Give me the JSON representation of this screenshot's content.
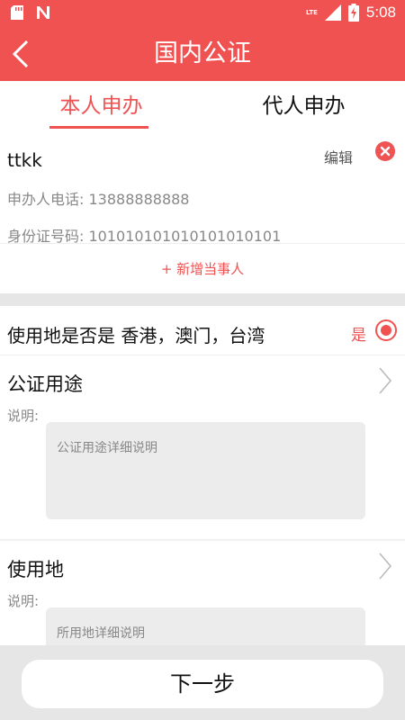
{
  "status_bar": {
    "time": "5:08",
    "network": "LTE",
    "icons": [
      "sd-card-icon",
      "notification-n-icon",
      "signal-icon",
      "battery-charging-icon"
    ]
  },
  "header": {
    "title": "国内公证",
    "back_icon": "chevron-left-icon"
  },
  "tabs": [
    {
      "label": "本人申办",
      "active": true
    },
    {
      "label": "代人申办",
      "active": false
    }
  ],
  "party": {
    "name": "ttkk",
    "edit_label": "编辑",
    "phone_label": "申办人电话:",
    "phone": "13888888888",
    "id_label": "身份证号码:",
    "id_number": "101010101010101010101",
    "add_label": "+ 新增当事人"
  },
  "region": {
    "question": "使用地是否是  香港，澳门，台湾",
    "answer": "是"
  },
  "purpose": {
    "title": "公证用途",
    "desc_label": "说明:",
    "placeholder": "公证用途详细说明"
  },
  "location": {
    "title": "使用地",
    "desc_label": "说明:",
    "placeholder": "所用地详细说明"
  },
  "footer": {
    "next_label": "下一步"
  },
  "colors": {
    "accent": "#f05252",
    "background": "#f2f2f2",
    "input_bg": "#ececec"
  }
}
